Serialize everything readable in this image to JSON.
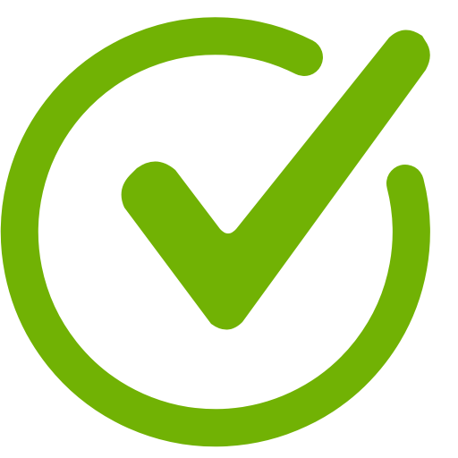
{
  "icon": {
    "name": "check-circle-icon",
    "color": "#71b204",
    "background": "#ffffff"
  }
}
